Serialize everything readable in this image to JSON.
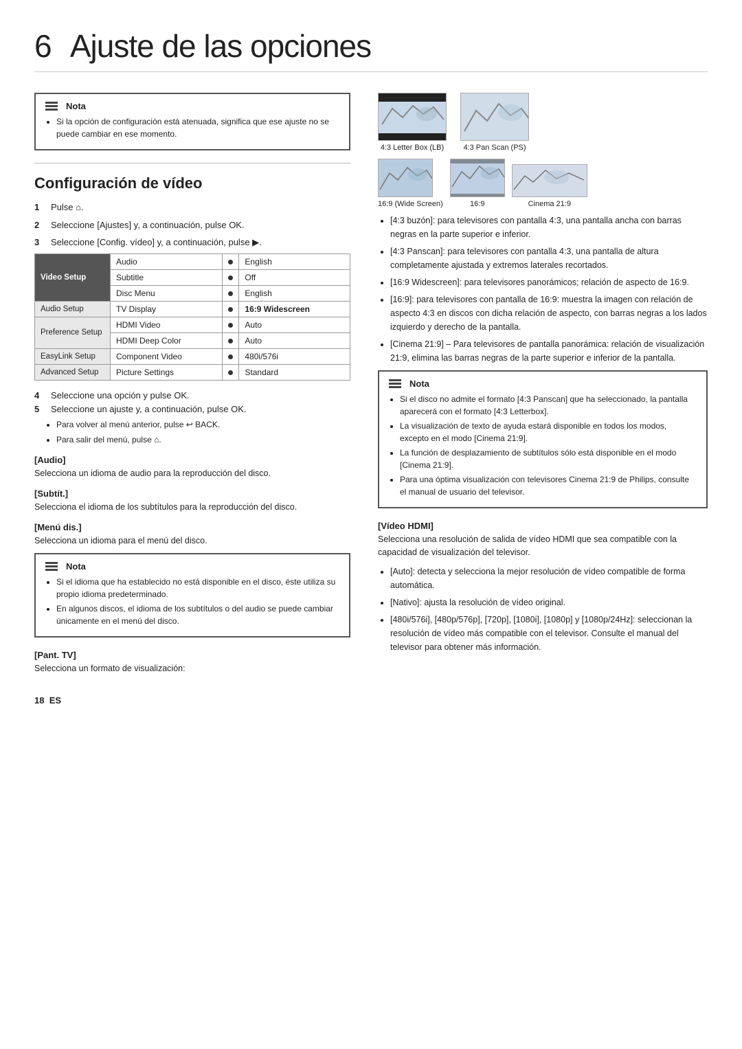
{
  "page": {
    "chapter_num": "6",
    "title": "Ajuste de las opciones"
  },
  "nota1": {
    "label": "Nota",
    "items": [
      "Si la opción de configuración está atenuada, significa que ese ajuste no se puede cambiar en ese momento."
    ]
  },
  "config_video": {
    "title": "Configuración de vídeo",
    "steps": [
      {
        "num": "1",
        "text": "Pulse",
        "icon": "home"
      },
      {
        "num": "2",
        "text": "Seleccione [Ajustes] y, a continuación, pulse OK."
      },
      {
        "num": "3",
        "text": "Seleccione [Config. vídeo] y, a continuación, pulse ▶."
      }
    ],
    "table": {
      "sidebar": [
        {
          "label": "Video Setup",
          "active": true
        },
        {
          "label": "Audio Setup",
          "active": false
        },
        {
          "label": "Preference Setup",
          "active": false
        },
        {
          "label": "EasyLink Setup",
          "active": false
        },
        {
          "label": "Advanced Setup",
          "active": false
        }
      ],
      "rows": [
        {
          "setting": "Audio",
          "value": "English"
        },
        {
          "setting": "Subtitle",
          "value": "Off"
        },
        {
          "setting": "Disc Menu",
          "value": "English"
        },
        {
          "setting": "TV Display",
          "value": "16:9 Widescreen",
          "highlight": true
        },
        {
          "setting": "HDMI Video",
          "value": "Auto"
        },
        {
          "setting": "HDMI Deep Color",
          "value": "Auto"
        },
        {
          "setting": "Component Video",
          "value": "480i/576i"
        },
        {
          "setting": "Picture Settings",
          "value": "Standard"
        }
      ]
    },
    "step4": "4",
    "step4_text": "Seleccione una opción y pulse OK.",
    "step5": "5",
    "step5_text": "Seleccione un ajuste y, a continuación, pulse OK.",
    "sub5a": "Para volver al menú anterior, pulse",
    "sub5a2": "BACK.",
    "sub5b": "Para salir del menú, pulse"
  },
  "audio_section": {
    "title": "[Audio]",
    "text": "Selecciona un idioma de audio para la reproducción del disco."
  },
  "subtit_section": {
    "title": "[Subtít.]",
    "text": "Selecciona el idioma de los subtítulos para la reproducción del disco."
  },
  "menu_dis_section": {
    "title": "[Menú dis.]",
    "text": "Selecciona un idioma para el menú del disco."
  },
  "nota2": {
    "label": "Nota",
    "items": [
      "Si el idioma que ha establecido no está disponible en el disco, éste utiliza su propio idioma predeterminado.",
      "En algunos discos, el idioma de los subtítulos o del audio se puede cambiar únicamente en el menú del disco."
    ]
  },
  "pant_tv_section": {
    "title": "[Pant. TV]",
    "text": "Selecciona un formato de visualización:"
  },
  "tv_formats": {
    "row1": [
      {
        "label": "4:3 Letter Box (LB)",
        "type": "lb"
      },
      {
        "label": "4:3 Pan Scan (PS)",
        "type": "ps"
      }
    ],
    "row2": [
      {
        "label": "16:9 (Wide Screen)",
        "type": "ws"
      },
      {
        "label": "16:9",
        "type": "s16"
      },
      {
        "label": "Cinema 21:9",
        "type": "cin"
      }
    ]
  },
  "format_bullets": [
    "[4:3 buzón]: para televisores con pantalla 4:3, una pantalla ancha con barras negras en la parte superior e inferior.",
    "[4:3 Panscan]: para televisores con pantalla 4:3, una pantalla de altura completamente ajustada y extremos laterales recortados.",
    "[16:9 Widescreen]: para televisores panorámicos; relación de aspecto de 16:9.",
    "[16:9]: para televisores con pantalla de 16:9: muestra la imagen con relación de aspecto 4:3 en discos con dicha relación de aspecto, con barras negras a los lados izquierdo y derecho de la pantalla.",
    "[Cinema 21:9] – Para televisores de pantalla panorámica: relación de visualización 21:9, elimina las barras negras de la parte superior e inferior de la pantalla."
  ],
  "nota3": {
    "label": "Nota",
    "items": [
      "Si el disco no admite el formato [4:3 Panscan] que ha seleccionado, la pantalla aparecerá con el formato [4:3 Letterbox].",
      "La visualización de texto de ayuda estará disponible en todos los modos, excepto en el modo [Cinema 21:9].",
      "La función de desplazamiento de subtítulos sólo está disponible en el modo [Cinema 21:9].",
      "Para una óptima visualización con televisores Cinema 21:9 de Philips, consulte el manual de usuario del televisor."
    ]
  },
  "hdmi_video_section": {
    "title": "[Vídeo HDMI]",
    "text": "Selecciona una resolución de salida de vídeo HDMI que sea compatible con la capacidad de visualización del televisor.",
    "bullets": [
      "[Auto]: detecta y selecciona la mejor resolución de vídeo compatible de forma automática.",
      "[Nativo]: ajusta la resolución de vídeo original.",
      "[480i/576i], [480p/576p], [720p], [1080i], [1080p] y [1080p/24Hz]: seleccionan la resolución de vídeo más compatible con el televisor. Consulte el manual del televisor para obtener más información."
    ]
  },
  "footer": {
    "page_num": "18",
    "lang": "ES"
  }
}
